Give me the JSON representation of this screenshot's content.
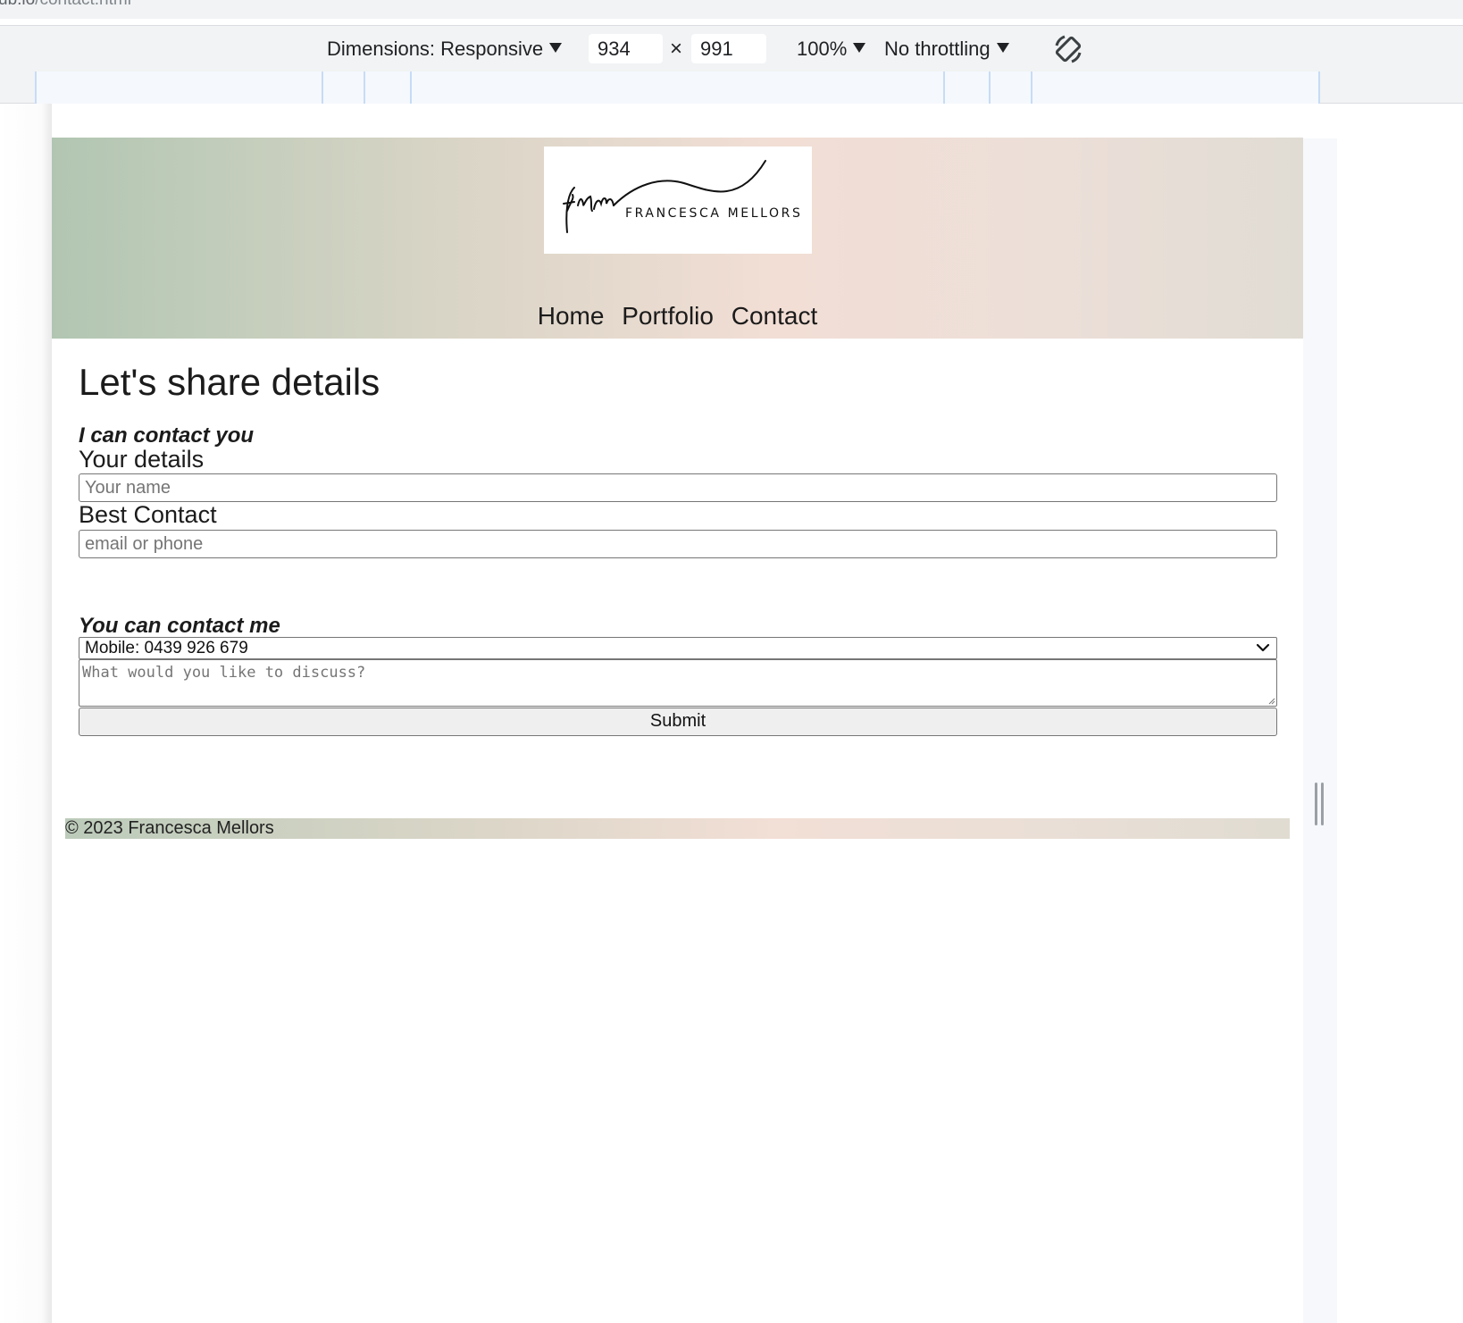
{
  "browser": {
    "url_host": "ub.io",
    "url_path": "/contact.html"
  },
  "device_toolbar": {
    "dimensions_label": "Dimensions: Responsive",
    "width": "934",
    "times": "×",
    "height": "991",
    "zoom": "100%",
    "throttling": "No throttling",
    "rotate_icon": "rotate-icon"
  },
  "site": {
    "logo_monogram": "fnm",
    "logo_name": "FRANCESCA MELLORS",
    "nav": [
      "Home",
      "Portfolio",
      "Contact"
    ],
    "page_title": "Let's share details",
    "section1": {
      "heading": "I can contact you",
      "details_label": "Your details",
      "name_placeholder": "Your name",
      "contact_label": "Best Contact",
      "contact_placeholder": "email or phone"
    },
    "section2": {
      "heading": "You can contact me",
      "selected_option": "Mobile: 0439 926 679",
      "message_placeholder": "What would you like to discuss?",
      "submit_label": "Submit"
    },
    "footer": "© 2023 Francesca Mellors"
  },
  "colors": {
    "header_gradient_start": "#b1c6b2",
    "header_gradient_mid": "#f2ded5",
    "header_gradient_end": "#e0dcd4"
  }
}
